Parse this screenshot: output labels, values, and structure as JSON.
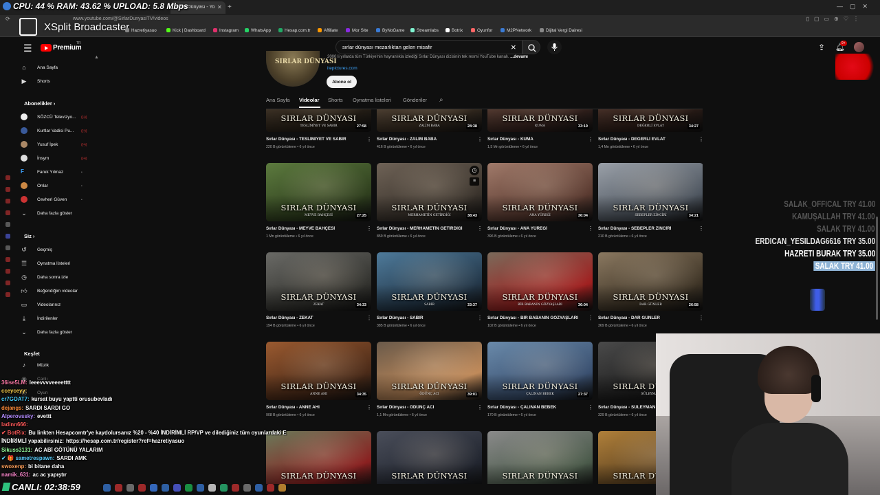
{
  "overlay": {
    "stats": "CPU: 44 % RAM: 43.62 % UPLOAD: 5.8 Mbps",
    "app_title": "XSplit Broadcaster",
    "timer": "CANLI: 02:38:59"
  },
  "browser": {
    "tab_label": "Sırlar Dünyası - Yo",
    "url": "www.youtube.com/@SirlarDunyasiTV/videos",
    "bookmarks": [
      "Hazretiyasuo",
      "Kick | Dashboard",
      "Instagram",
      "WhatsApp",
      "Hesap.com.tr",
      "Affiliate",
      "Mor Site",
      "ByNoGame",
      "Streamlabs",
      "Botrix",
      "Oyunfor",
      "M2PNetwork",
      "Dijital Vergi Dairesi"
    ]
  },
  "yt": {
    "brand": "Premium",
    "tm": "TR",
    "search_query": "sırlar dünyası mezarlıktan gelen misafir",
    "notif_count": "9+"
  },
  "sidebar": {
    "main": [
      "Ana Sayfa",
      "Shorts"
    ],
    "subs_header": "Abonelikler",
    "subs": [
      "SÖZCÜ Televizyo...",
      "Kurtlar Vadisi Pu...",
      "Yusuf İpek",
      "İnsym",
      "Faruk Yılmaz",
      "Onlar",
      "Cevheri Güven"
    ],
    "show_more": "Daha fazla göster",
    "you_header": "Siz",
    "you_items": [
      "Geçmiş",
      "Oynatma listeleri",
      "Daha sonra izle",
      "Beğendiğim videolar",
      "Videolarınız",
      "İndirilenler",
      "Daha fazla göster"
    ],
    "explore_header": "Keşfet",
    "explore_items": [
      "Müzik",
      "Canlı",
      "Oyun"
    ]
  },
  "channel": {
    "avatar_text": "SIRLAR DÜNYASI",
    "desc": "2000 li yıllarda tüm Türkiye'nin hayranlıkla izlediği Sırlar Dünyası dizisinin tek resmi YouTube kanalı.",
    "desc_more": "...devamı",
    "link": "itepictures.com",
    "subscribe": "Abone ol",
    "tabs": [
      "Ana Sayfa",
      "Videolar",
      "Shorts",
      "Oynatma listeleri",
      "Gönderiler"
    ]
  },
  "thumb_brand": "SIRLAR DÜNYASI",
  "videos": [
    {
      "title": "Sırlar Dünyası - TESLİMİYET VE SABIR",
      "sub": "TESLİMİYET VE SABIR",
      "duration": "27:58",
      "views": "220 B görüntüleme",
      "age": "6 yıl önce",
      "colors": [
        "#5a4a3a",
        "#2a2218"
      ]
    },
    {
      "title": "Sırlar Dünyası - ZALİM BABA",
      "sub": "ZALİM BABA",
      "duration": "28:38",
      "views": "416 B görüntüleme",
      "age": "6 yıl önce",
      "colors": [
        "#6a5a4a",
        "#3a2e22"
      ]
    },
    {
      "title": "Sırlar Dünyası - KUMA",
      "sub": "KUMA",
      "duration": "33:19",
      "views": "1,5 Mn görüntüleme",
      "age": "6 yıl önce",
      "colors": [
        "#7a5a4a",
        "#3a2520"
      ]
    },
    {
      "title": "Sırlar Dünyası - DEĞERLİ EVLAT",
      "sub": "DEĞERLİ EVLAT",
      "duration": "34:27",
      "views": "1,4 Mn görüntüleme",
      "age": "6 yıl önce",
      "colors": [
        "#6a4a3e",
        "#2e1e18"
      ]
    },
    {
      "title": "Sırlar Dünyası - MEYVE BAHÇESİ",
      "sub": "MEYVE BAHÇESİ",
      "duration": "27:25",
      "views": "1 Mn görüntüleme",
      "age": "6 yıl önce",
      "colors": [
        "#5c7a3e",
        "#2f3f1e"
      ]
    },
    {
      "title": "Sırlar Dünyası - MERHAMETİN GETİRDİĞİ",
      "sub": "MERHAMETİN GETİRDİĞİ",
      "duration": "38:43",
      "views": "859 B görüntüleme",
      "age": "6 yıl önce",
      "colors": [
        "#6e6256",
        "#3a332c"
      ]
    },
    {
      "title": "Sırlar Dünyası - ANA YÜREĞİ",
      "sub": "ANA YÜREĞİ",
      "duration": "36:04",
      "views": "396 B görüntüleme",
      "age": "6 yıl önce",
      "colors": [
        "#a07a6a",
        "#5a3a30"
      ]
    },
    {
      "title": "Sırlar Dünyası - SEBEPLER ZİNCİRİ",
      "sub": "SEBEPLER ZİNCİRİ",
      "duration": "34:21",
      "views": "210 B görüntüleme",
      "age": "6 yıl önce",
      "colors": [
        "#9aa0a8",
        "#4e5660"
      ]
    },
    {
      "title": "Sırlar Dünyası - ZEKAT",
      "sub": "ZEKAT",
      "duration": "34:33",
      "views": "194 B görüntüleme",
      "age": "6 yıl önce",
      "colors": [
        "#6a6a66",
        "#33332f"
      ]
    },
    {
      "title": "Sırlar Dünyası - SABIR",
      "sub": "SABIR",
      "duration": "33:37",
      "views": "385 B görüntüleme",
      "age": "6 yıl önce",
      "colors": [
        "#4e7a9a",
        "#24384a"
      ]
    },
    {
      "title": "Sırlar Dünyası - BİR BABANIN GÖZYAŞLARI",
      "sub": "BİR BABANIN GÖZYAŞLARI",
      "duration": "36:04",
      "views": "102 B görüntüleme",
      "age": "6 yıl önce",
      "colors": [
        "#7a6a5a",
        "#a02020"
      ]
    },
    {
      "title": "Sırlar Dünyası - DAR GÜNLER",
      "sub": "DAR GÜNLER",
      "duration": "26:58",
      "views": "369 B görüntüleme",
      "age": "6 yıl önce",
      "colors": [
        "#8a7860",
        "#3e3426"
      ]
    },
    {
      "title": "Sırlar Dünyası - ANNE AHI",
      "sub": "ANNE AHI",
      "duration": "34:35",
      "views": "908 B görüntüleme",
      "age": "6 yıl önce",
      "colors": [
        "#9a5a30",
        "#4a2a18"
      ]
    },
    {
      "title": "Sırlar Dünyası - ÖDÜNÇ ACI",
      "sub": "ÖDÜNÇ ACI",
      "duration": "39:01",
      "views": "1,1 Mn görüntüleme",
      "age": "6 yıl önce",
      "colors": [
        "#6a5a4a",
        "#c08a5a"
      ]
    },
    {
      "title": "Sırlar Dünyası - ÇALINAN BEBEK",
      "sub": "ÇALINAN BEBEK",
      "duration": "27:37",
      "views": "170 B görüntüleme",
      "age": "6 yıl önce",
      "colors": [
        "#6a8aaa",
        "#3a5070"
      ]
    },
    {
      "title": "Sırlar Dünyası - SÜLEYMAN",
      "sub": "SÜLEYMAN",
      "duration": "",
      "views": "329 B görüntüleme",
      "age": "6 yıl önce",
      "colors": [
        "#4a4a4a",
        "#1e1e1e"
      ]
    },
    {
      "title": "",
      "sub": "",
      "duration": "",
      "views": "",
      "age": "",
      "colors": [
        "#6a7a5a",
        "#8a2020"
      ]
    },
    {
      "title": "",
      "sub": "",
      "duration": "",
      "views": "",
      "age": "",
      "colors": [
        "#4a4e5a",
        "#222630"
      ]
    },
    {
      "title": "",
      "sub": "",
      "duration": "",
      "views": "",
      "age": "",
      "colors": [
        "#8a8a8a",
        "#4a5a4a"
      ]
    },
    {
      "title": "",
      "sub": "",
      "duration": "",
      "views": "",
      "age": "",
      "colors": [
        "#b0803a",
        "#5a4020"
      ]
    }
  ],
  "donations": [
    {
      "text": "SALAK_OFFICAL TRY 41.00",
      "hi": false
    },
    {
      "text": "KAMUŞALLAH TRY 41.00",
      "hi": false
    },
    {
      "text": "SALAK TRY 41.00",
      "hi": false
    },
    {
      "text": "ERDICAN_YESILDAG6616 TRY 35.00",
      "hi": false
    },
    {
      "text": "HAZRETI BURAK TRY 35.00",
      "hi": false
    },
    {
      "text": "SALAK TRY 41.00",
      "hi": true
    }
  ],
  "chat": [
    {
      "user": "36ise5LM:",
      "msg": "leeevvvveeeetttt",
      "color": "#ff7aa8"
    },
    {
      "user": "cceyceyy:",
      "msg": "",
      "color": "#ffd34d"
    },
    {
      "user": "cr7GOAT7:",
      "msg": "kursat buyu yaptti orusubevladı",
      "color": "#47d0ff"
    },
    {
      "user": "dejangs:",
      "msg": "SARDI SARDI GO",
      "color": "#ff8c3a"
    },
    {
      "user": "Alperovssky:",
      "msg": "evettt",
      "color": "#b48cff"
    },
    {
      "user": "ladinn666:",
      "msg": "",
      "color": "#ff5a5a"
    },
    {
      "user": "✔ BotRix:",
      "msg": "Bu linkten Hesapcomtr'ye kaydolursanız %20 - %40 İNDİRİMLİ RP/VP ve dilediğiniz tüm oyunlardaki E",
      "color": "#ff5a5a"
    },
    {
      "user": "İNDİRİMLİ yapabilirsiniz:",
      "msg": "https://hesap.com.tr/register?ref=hazretiyasuo",
      "color": "#ffffff"
    },
    {
      "user": "Sikuss3131:",
      "msg": "AC ABİ GÖTÜNÜ YALARIM",
      "color": "#9affa0"
    },
    {
      "user": "✔ 🎁 sametrespawn:",
      "msg": "SARDI AMK",
      "color": "#5ad0ff"
    },
    {
      "user": "swoxenp:",
      "msg": "bi bitane daha",
      "color": "#ffa05a"
    },
    {
      "user": "namik_631:",
      "msg": "ac ac yapıştır",
      "color": "#ff8ad0"
    }
  ]
}
